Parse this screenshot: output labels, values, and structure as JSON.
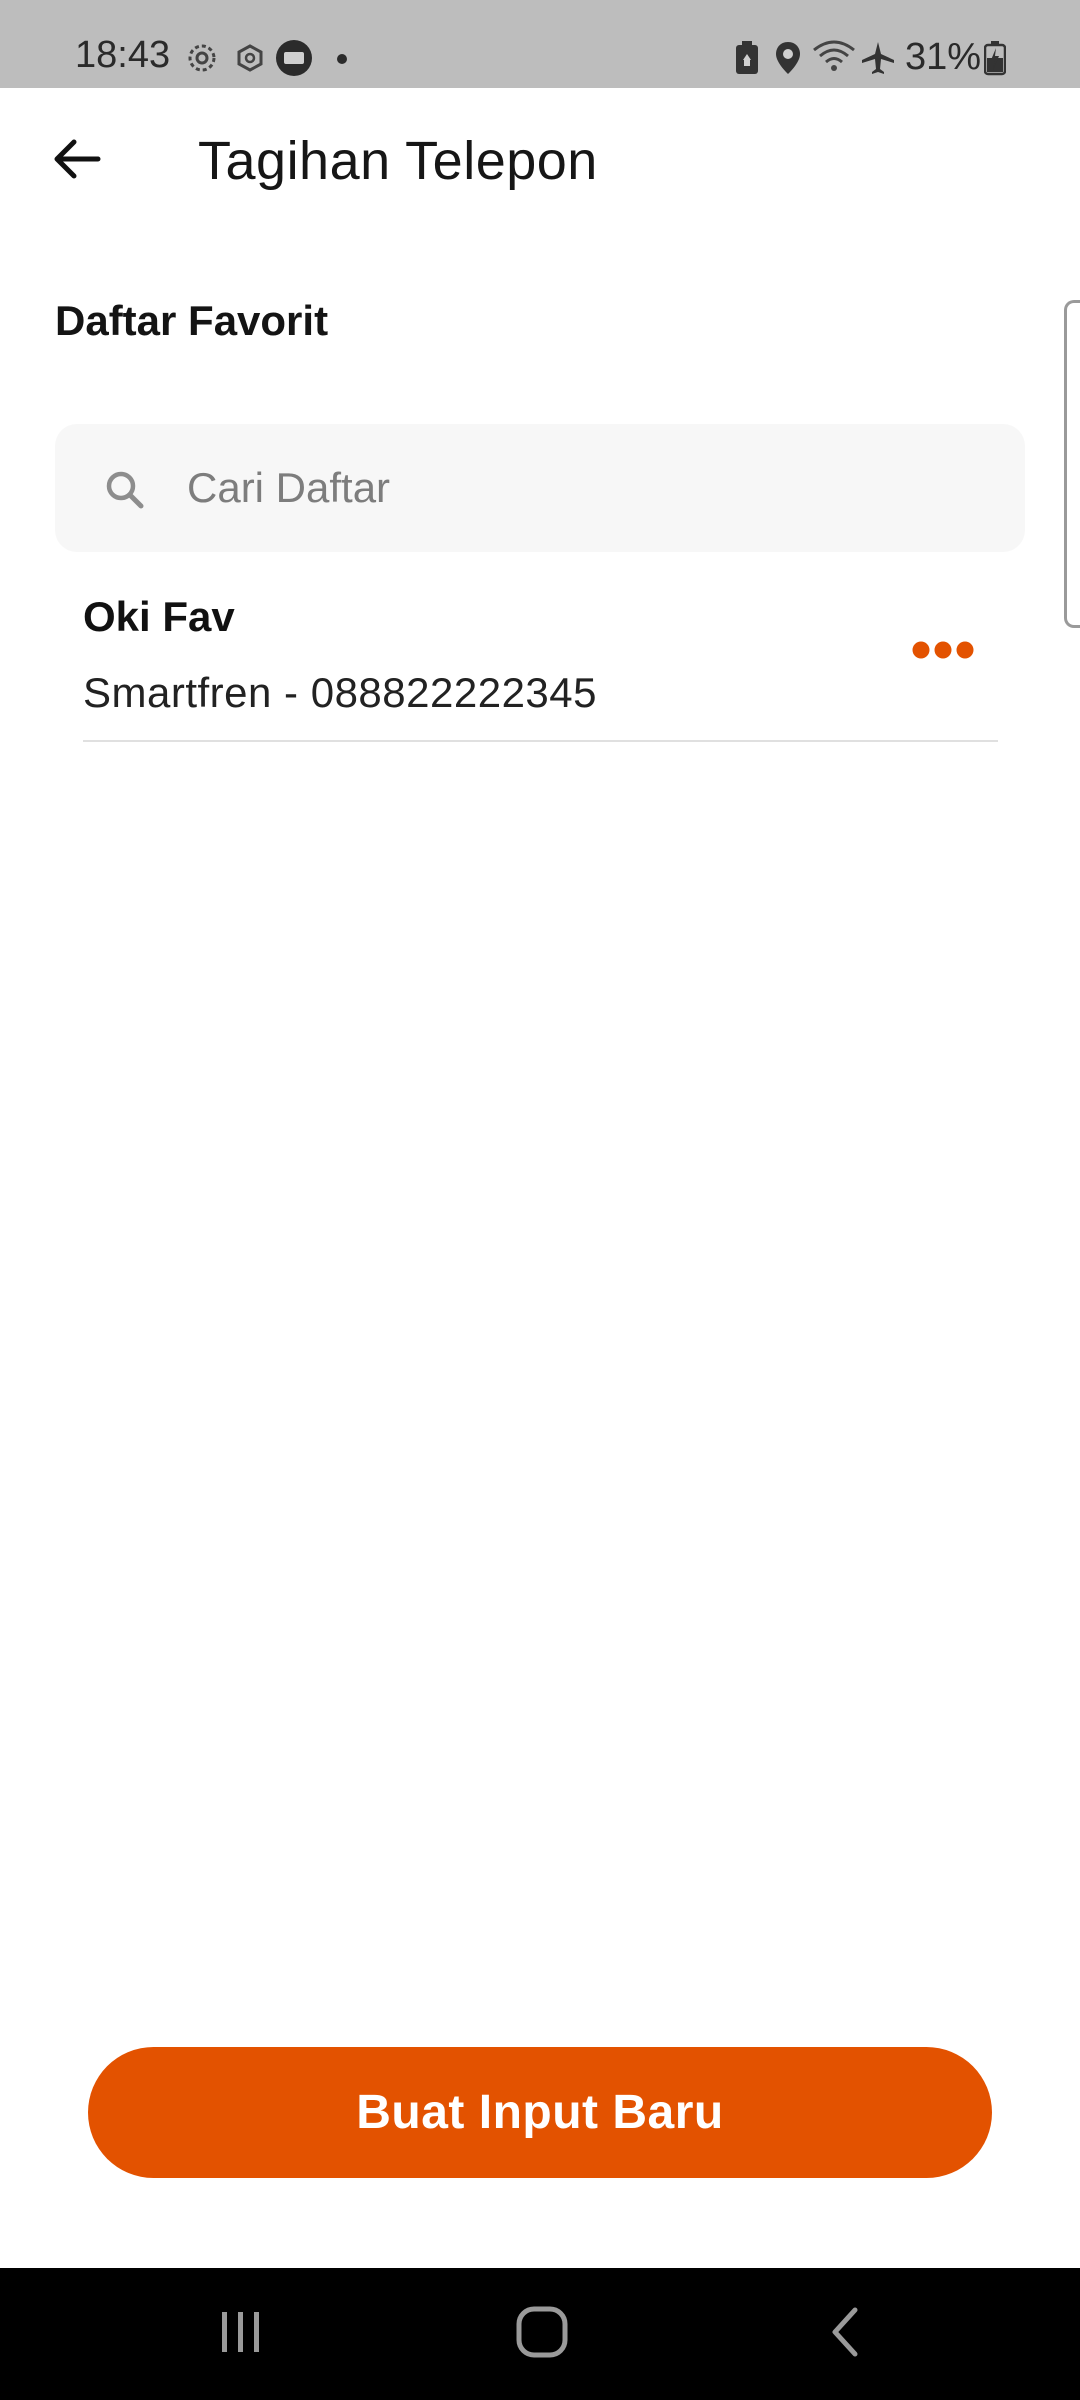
{
  "status_bar": {
    "time": "18:43",
    "battery_text": "31%",
    "left_icons": [
      "settings-gear-icon",
      "gear-outline-icon",
      "chat-bubble-icon",
      "notification-dot-icon"
    ],
    "right_icons": [
      "battery-saver-icon",
      "location-pin-icon",
      "wifi-icon",
      "airplane-icon",
      "battery-charging-icon"
    ]
  },
  "header": {
    "back_icon": "arrow-left-icon",
    "title": "Tagihan Telepon"
  },
  "favorites": {
    "section_title": "Daftar Favorit",
    "search": {
      "placeholder": "Cari Daftar",
      "value": "",
      "icon": "search-icon"
    },
    "items": [
      {
        "name": "Oki Fav",
        "detail": "Smartfren - 088822222345",
        "menu_icon": "more-horizontal-icon"
      }
    ]
  },
  "actions": {
    "new_input_label": "Buat Input Baru"
  },
  "nav_bar": {
    "icons": [
      "recent-apps-icon",
      "home-icon",
      "back-icon"
    ]
  },
  "colors": {
    "accent": "#E35200",
    "status_bar_bg": "#BDBDBD",
    "nav_bar_bg": "#000000",
    "search_bg": "#F7F7F7",
    "divider": "#E0E0E0"
  }
}
